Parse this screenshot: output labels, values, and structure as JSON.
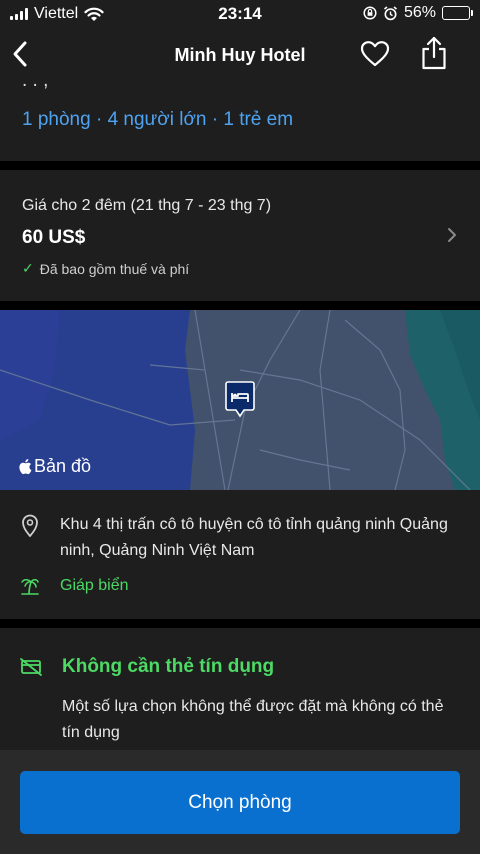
{
  "status_bar": {
    "carrier": "Viettel",
    "time": "23:14",
    "battery_percent": "56%",
    "battery_level": 0.56,
    "icons": [
      "signal-icon",
      "wifi-icon",
      "rotation-lock-icon",
      "alarm-icon",
      "battery-icon"
    ]
  },
  "nav": {
    "title": "Minh Huy Hotel",
    "icons": [
      "back-icon",
      "heart-icon",
      "share-icon"
    ]
  },
  "guests": {
    "summary": "1 phòng · 4 người lớn · 1 trẻ em"
  },
  "price": {
    "label": "Giá cho 2 đêm (21 thg 7 - 23 thg 7)",
    "value": "60 US$",
    "check_mark": "✓",
    "includes": "Đã bao gồm thuế và phí"
  },
  "map": {
    "label": "Bản đồ",
    "icons": [
      "apple-logo-icon",
      "hotel-pin-icon"
    ]
  },
  "address": {
    "text": "Khu 4 thị trấn cô tô huyện cô tô tỉnh quảng ninh Quảng ninh, Quảng Ninh Việt Nam",
    "beach": "Giáp biển"
  },
  "credit": {
    "title": "Không cần thẻ tín dụng",
    "description": "Một số lựa chọn không thể được đặt mà không có thẻ tín dụng"
  },
  "cta": {
    "label": "Chọn phòng"
  },
  "colors": {
    "accent_blue": "#4ea3f1",
    "button_blue": "#0a70d0",
    "green": "#4cd964",
    "card_bg": "#1e1e1e"
  }
}
